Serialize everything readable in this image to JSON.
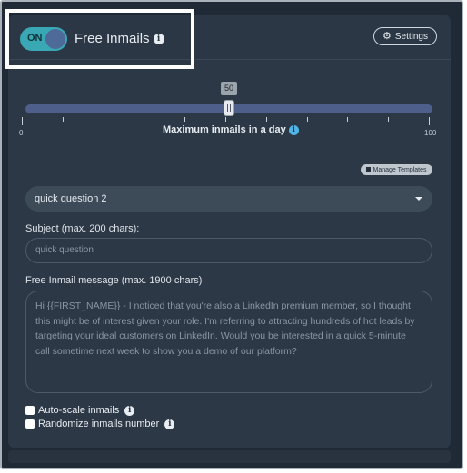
{
  "header": {
    "toggle_label": "ON",
    "title": "Free Inmails",
    "settings_label": "Settings"
  },
  "slider": {
    "value": "50",
    "fraction": 0.5,
    "min_label": "0",
    "max_label": "100",
    "caption": "Maximum inmails in a day"
  },
  "templates": {
    "manage_label": "Manage Templates",
    "selected": "quick question 2"
  },
  "subject": {
    "label": "Subject (max. 200 chars):",
    "value": "quick question"
  },
  "message": {
    "label": "Free Inmail message (max. 1900 chars)",
    "lines": [
      "Hi {{FIRST_NAME}} - I noticed that you're also a LinkedIn premium member, so I thought",
      "this might be of interest given your role. I'm referring to attracting hundreds of hot leads by",
      "targeting your ideal customers on LinkedIn. Would you be interested in a quick 5-minute",
      "call sometime next week to show you a demo of our platform?"
    ]
  },
  "options": {
    "auto_scale_label": "Auto-scale inmails",
    "randomize_label": "Randomize inmails number"
  },
  "icons": {
    "info": "info-icon",
    "gear": "gear-icon",
    "document": "document-icon",
    "caret": "chevron-down-icon"
  },
  "colors": {
    "toggle_on": "#3aa8b4",
    "slider_track": "#4f5f8c",
    "info_accent": "#4fb5e6"
  }
}
